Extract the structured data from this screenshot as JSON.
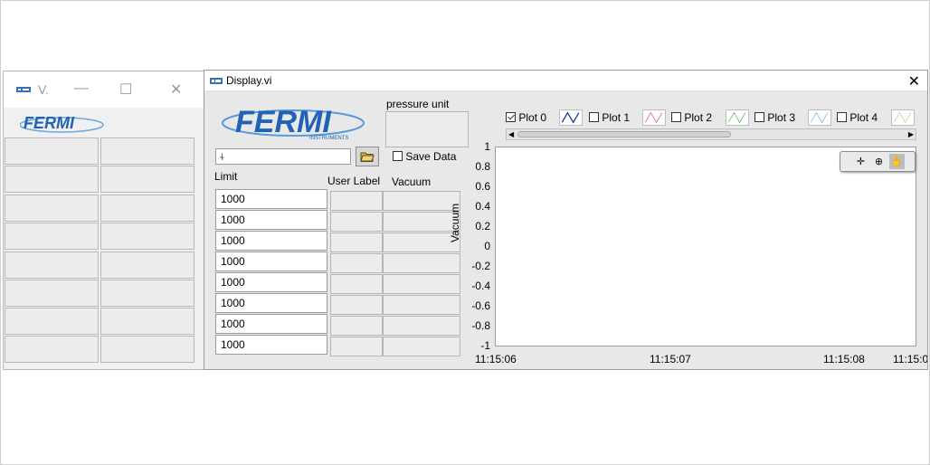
{
  "back_window": {
    "title": "V.",
    "controls": {
      "minimize": "—",
      "maximize": "☐",
      "close": "✕"
    },
    "logo_text": "FERMI",
    "logo_sub": "INSTRUMENTS"
  },
  "front_window": {
    "title": "Display.vi",
    "close": "✕",
    "logo_text": "FERMI",
    "logo_sub": "INSTRUMENTS",
    "path_icon": "⍭",
    "browse_icon": "folder-open-icon",
    "pressure_unit_label": "pressure unit",
    "save_data_label": "Save Data",
    "save_data_checked": false,
    "limit_label": "Limit",
    "user_label_header": "User Label",
    "vacuum_header": "Vacuum",
    "limits": [
      "1000",
      "1000",
      "1000",
      "1000",
      "1000",
      "1000",
      "1000",
      "1000"
    ]
  },
  "legend": [
    {
      "label": "Plot 0",
      "checked": true,
      "color": "#1a3f9a"
    },
    {
      "label": "Plot 1",
      "checked": false,
      "color": "#e07070"
    },
    {
      "label": "Plot 2",
      "checked": false,
      "color": "#6fc06f"
    },
    {
      "label": "Plot 3",
      "checked": false,
      "color": "#7fc4e6"
    },
    {
      "label": "Plot 4",
      "checked": false,
      "color": "#c8d8a8"
    }
  ],
  "graph": {
    "ylabel": "Vacuum",
    "yticks": [
      "1",
      "0.8",
      "0.6",
      "0.4",
      "0.2",
      "0",
      "-0.2",
      "-0.4",
      "-0.6",
      "-0.8",
      "-1"
    ],
    "xticks": [
      "11:15:06",
      "11:15:07",
      "11:15:08",
      "11:15:0"
    ],
    "palette": [
      "crosshair-icon",
      "zoom-icon",
      "pan-hand-icon"
    ]
  },
  "chart_data": {
    "type": "line",
    "title": "",
    "xlabel": "",
    "ylabel": "Vacuum",
    "ylim": [
      -1,
      1
    ],
    "xticks": [
      "11:15:06",
      "11:15:07",
      "11:15:08",
      "11:15:0"
    ],
    "series": []
  },
  "colors": {
    "logo_blue": "#1f62b6",
    "panel": "#e8e8e8"
  }
}
